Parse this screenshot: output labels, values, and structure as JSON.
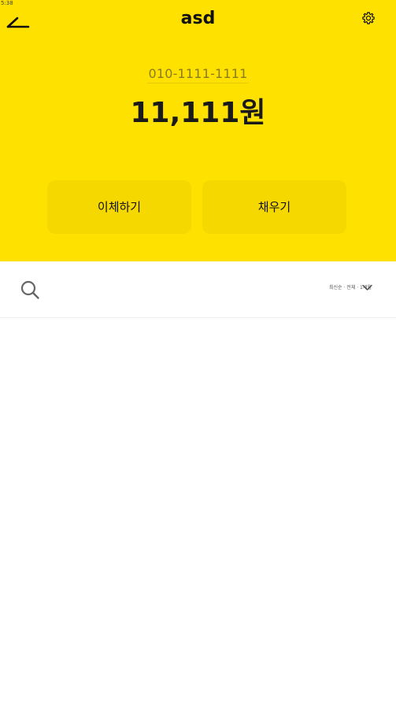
{
  "status_bar": {
    "time": "5:38"
  },
  "header": {
    "title": "asd",
    "back_icon": "back-arrow-icon",
    "settings_icon": "gear-icon"
  },
  "account": {
    "number": "010-1111-1111",
    "balance": "11,111원"
  },
  "actions": {
    "transfer_label": "이체하기",
    "fill_label": "채우기"
  },
  "filter": {
    "search_icon": "search-icon",
    "period_label": "최신순 · 전체 · 1개월",
    "dropdown_icon": "chevron-down-icon"
  },
  "colors": {
    "header_background": "#ffe100",
    "button_background": "#f5d800",
    "text_primary": "#1a1a1a",
    "account_number_text": "#8a7a20"
  }
}
